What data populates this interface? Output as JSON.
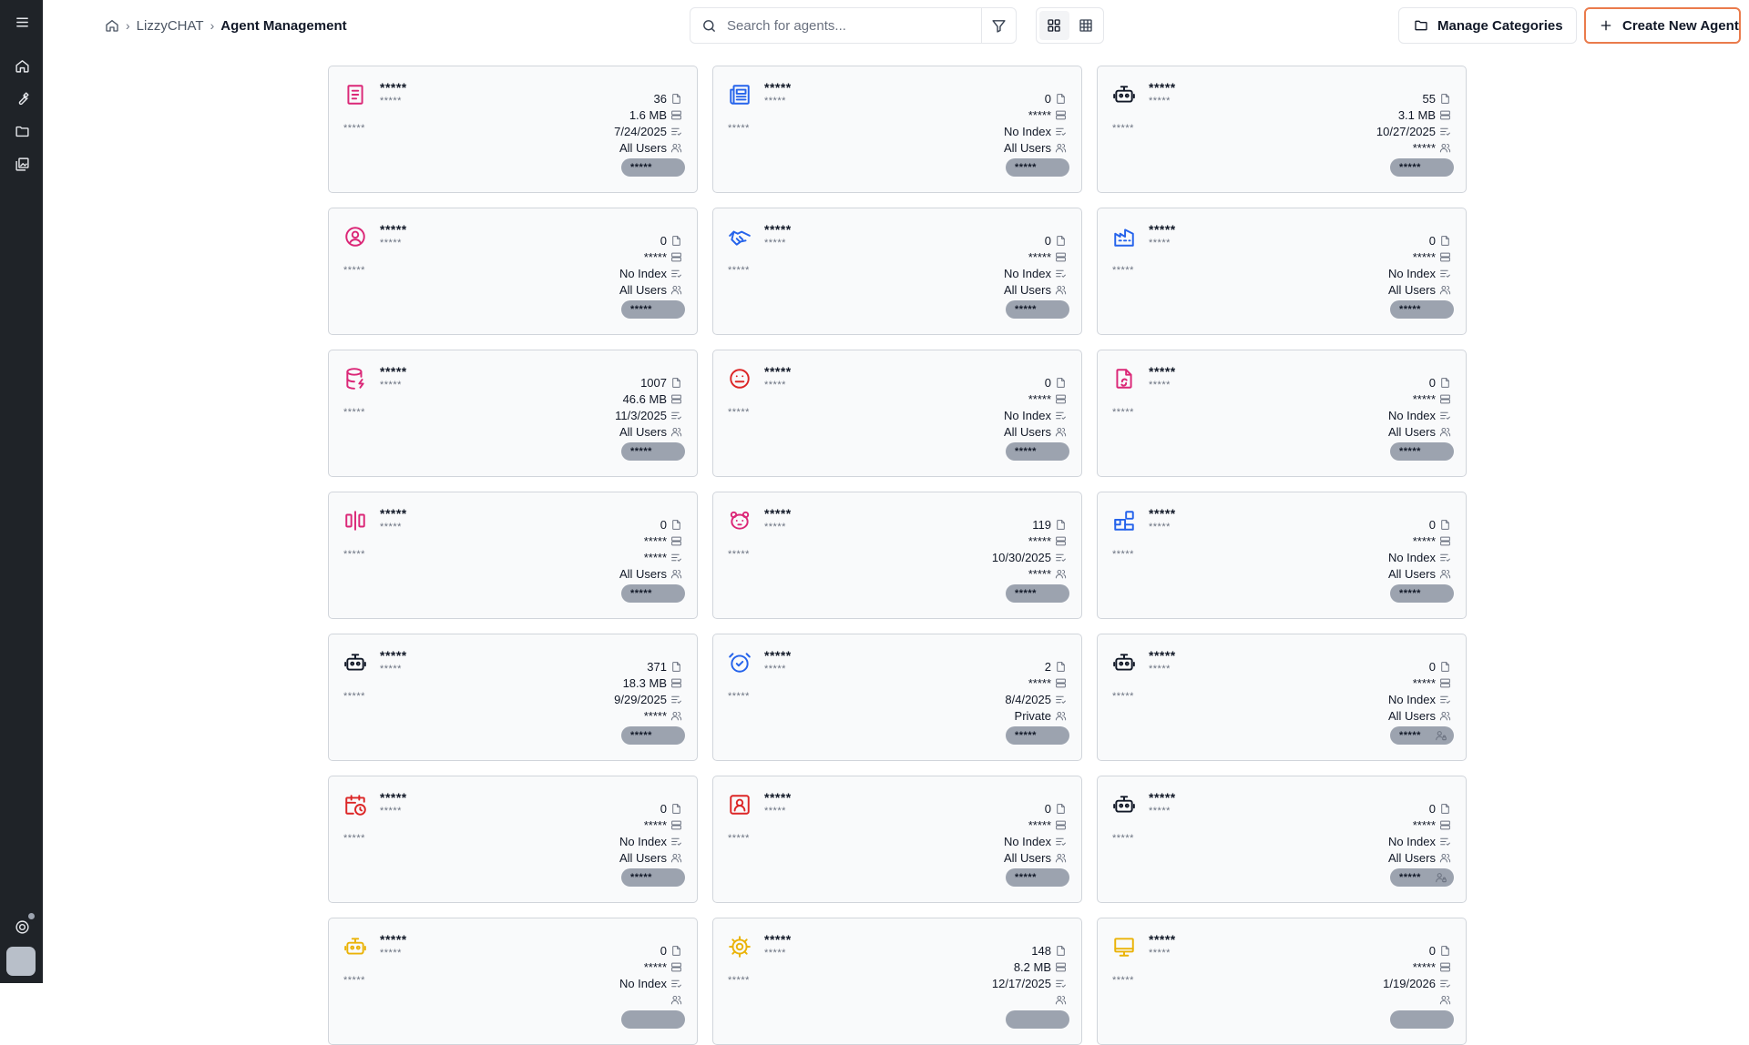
{
  "breadcrumb": {
    "items": [
      "LizzyCHAT",
      "Agent Management"
    ]
  },
  "search": {
    "placeholder": "Search for agents..."
  },
  "buttons": {
    "manage_categories": "Manage Categories",
    "create_new": "Create New Agent"
  },
  "colors": {
    "rail": "#1f2328",
    "accent": "#ea7b4c",
    "pill": "#9ca3af"
  },
  "cards": [
    {
      "icon": "document-text-icon",
      "color": "#db2777",
      "name": "*****",
      "category": "*****",
      "desc": "*****",
      "documents": "36",
      "size": "1.6 MB",
      "index": "7/24/2025",
      "access": "All Users",
      "badge": "*****"
    },
    {
      "icon": "newspaper-icon",
      "color": "#2563eb",
      "name": "*****",
      "category": "*****",
      "desc": "*****",
      "documents": "0",
      "size": "*****",
      "index": "No Index",
      "access": "All Users",
      "badge": "*****"
    },
    {
      "icon": "robot-icon",
      "color": "#111827",
      "name": "*****",
      "category": "*****",
      "desc": "*****",
      "documents": "55",
      "size": "3.1 MB",
      "index": "10/27/2025",
      "access": "*****",
      "badge": "*****"
    },
    {
      "icon": "user-circle-icon",
      "color": "#db2777",
      "name": "*****",
      "category": "*****",
      "desc": "*****",
      "documents": "0",
      "size": "*****",
      "index": "No Index",
      "access": "All Users",
      "badge": "*****"
    },
    {
      "icon": "handshake-icon",
      "color": "#2563eb",
      "name": "*****",
      "category": "*****",
      "desc": "*****",
      "documents": "0",
      "size": "*****",
      "index": "No Index",
      "access": "All Users",
      "badge": "*****"
    },
    {
      "icon": "factory-icon",
      "color": "#2563eb",
      "name": "*****",
      "category": "*****",
      "desc": "*****",
      "documents": "0",
      "size": "*****",
      "index": "No Index",
      "access": "All Users",
      "badge": "*****"
    },
    {
      "icon": "database-bolt-icon",
      "color": "#db2777",
      "name": "*****",
      "category": "*****",
      "desc": "*****",
      "documents": "1007",
      "size": "46.6 MB",
      "index": "11/3/2025",
      "access": "All Users",
      "badge": "*****"
    },
    {
      "icon": "face-neutral-icon",
      "color": "#dc2626",
      "name": "*****",
      "category": "*****",
      "desc": "*****",
      "documents": "0",
      "size": "*****",
      "index": "No Index",
      "access": "All Users",
      "badge": "*****"
    },
    {
      "icon": "file-refresh-icon",
      "color": "#db2777",
      "name": "*****",
      "category": "*****",
      "desc": "*****",
      "documents": "0",
      "size": "*****",
      "index": "No Index",
      "access": "All Users",
      "badge": "*****"
    },
    {
      "icon": "align-center-icon",
      "color": "#db2777",
      "name": "*****",
      "category": "*****",
      "desc": "*****",
      "documents": "0",
      "size": "*****",
      "index": "*****",
      "access": "All Users",
      "badge": "*****"
    },
    {
      "icon": "bear-icon",
      "color": "#db2777",
      "name": "*****",
      "category": "*****",
      "desc": "*****",
      "documents": "119",
      "size": "*****",
      "index": "10/30/2025",
      "access": "*****",
      "badge": "*****"
    },
    {
      "icon": "blocks-icon",
      "color": "#2563eb",
      "name": "*****",
      "category": "*****",
      "desc": "*****",
      "documents": "0",
      "size": "*****",
      "index": "No Index",
      "access": "All Users",
      "badge": "*****"
    },
    {
      "icon": "robot-icon",
      "color": "#111827",
      "name": "*****",
      "category": "*****",
      "desc": "*****",
      "documents": "371",
      "size": "18.3 MB",
      "index": "9/29/2025",
      "access": "*****",
      "badge": "*****"
    },
    {
      "icon": "alarm-check-icon",
      "color": "#2563eb",
      "name": "*****",
      "category": "*****",
      "desc": "*****",
      "documents": "2",
      "size": "*****",
      "index": "8/4/2025",
      "access": "Private",
      "badge": "*****"
    },
    {
      "icon": "robot-icon",
      "color": "#111827",
      "name": "*****",
      "category": "*****",
      "desc": "*****",
      "documents": "0",
      "size": "*****",
      "index": "No Index",
      "access": "All Users",
      "badge": "*****",
      "locked": true
    },
    {
      "icon": "calendar-clock-icon",
      "color": "#dc2626",
      "name": "*****",
      "category": "*****",
      "desc": "*****",
      "documents": "0",
      "size": "*****",
      "index": "No Index",
      "access": "All Users",
      "badge": "*****"
    },
    {
      "icon": "contact-card-icon",
      "color": "#dc2626",
      "name": "*****",
      "category": "*****",
      "desc": "*****",
      "documents": "0",
      "size": "*****",
      "index": "No Index",
      "access": "All Users",
      "badge": "*****"
    },
    {
      "icon": "robot-icon",
      "color": "#111827",
      "name": "*****",
      "category": "*****",
      "desc": "*****",
      "documents": "0",
      "size": "*****",
      "index": "No Index",
      "access": "All Users",
      "badge": "*****",
      "locked": true
    },
    {
      "icon": "robot-icon",
      "color": "#eab308",
      "name": "*****",
      "category": "*****",
      "desc": "*****",
      "documents": "0",
      "size": "*****",
      "index": "No Index",
      "access": "",
      "badge": ""
    },
    {
      "icon": "gear-icon",
      "color": "#eab308",
      "name": "*****",
      "category": "*****",
      "desc": "*****",
      "documents": "148",
      "size": "8.2 MB",
      "index": "12/17/2025",
      "access": "",
      "badge": ""
    },
    {
      "icon": "monitor-icon",
      "color": "#eab308",
      "name": "*****",
      "category": "*****",
      "desc": "*****",
      "documents": "0",
      "size": "*****",
      "index": "1/19/2026",
      "access": "",
      "badge": ""
    }
  ]
}
